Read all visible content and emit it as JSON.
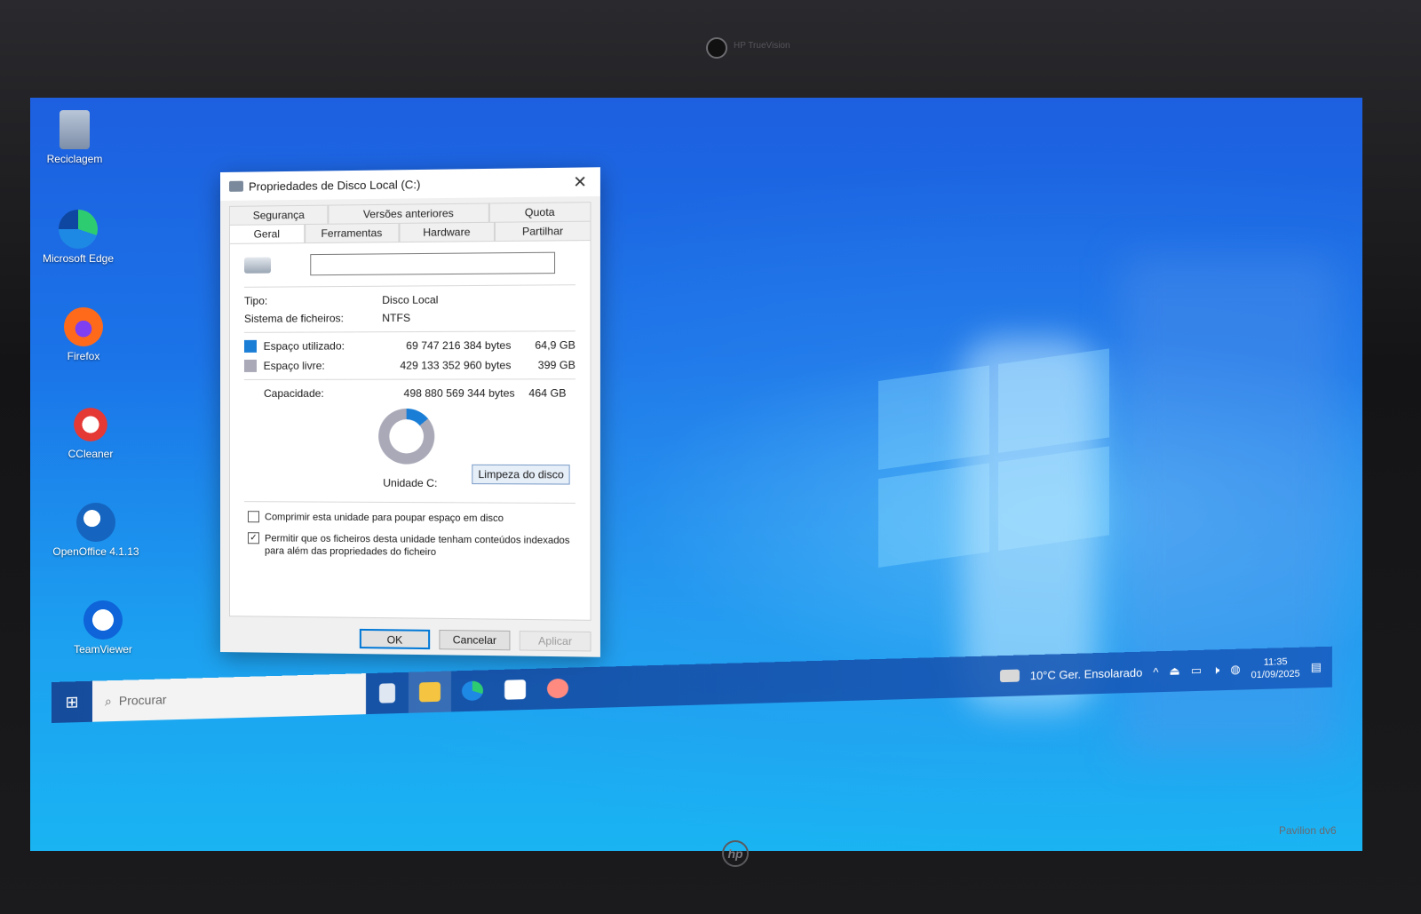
{
  "device": {
    "camera_label": "HP TrueVision",
    "brand": "hp",
    "model": "Pavilion dv6"
  },
  "desktop_icons": [
    {
      "label": "Reciclagem",
      "icon": "recycle-bin-icon"
    },
    {
      "label": "Microsoft Edge",
      "icon": "edge-icon"
    },
    {
      "label": "Firefox",
      "icon": "firefox-icon"
    },
    {
      "label": "CCleaner",
      "icon": "ccleaner-icon"
    },
    {
      "label": "OpenOffice 4.1.13",
      "icon": "openoffice-icon"
    },
    {
      "label": "TeamViewer",
      "icon": "teamviewer-icon"
    }
  ],
  "dialog": {
    "title": "Propriedades de Disco Local (C:)",
    "tabs_row1": [
      "Segurança",
      "Versões anteriores",
      "Quota"
    ],
    "tabs_row2": [
      "Geral",
      "Ferramentas",
      "Hardware",
      "Partilhar"
    ],
    "active_tab": "Geral",
    "drive_name_value": "",
    "type_label": "Tipo:",
    "type_value": "Disco Local",
    "fs_label": "Sistema de ficheiros:",
    "fs_value": "NTFS",
    "used": {
      "label": "Espaço utilizado:",
      "bytes": "69 747 216 384 bytes",
      "size": "64,9 GB",
      "color": "#1a7ed6"
    },
    "free": {
      "label": "Espaço livre:",
      "bytes": "429 133 352 960 bytes",
      "size": "399 GB",
      "color": "#a9a9b8"
    },
    "capacity": {
      "label": "Capacidade:",
      "bytes": "498 880 569 344 bytes",
      "size": "464 GB"
    },
    "used_fraction": 0.14,
    "drive_label": "Unidade C:",
    "cleanup_button": "Limpeza do disco",
    "compress_label": "Comprimir esta unidade para poupar espaço em disco",
    "compress_checked": false,
    "index_label": "Permitir que os ficheiros desta unidade tenham conteúdos indexados para além das propriedades do ficheiro",
    "index_checked": true,
    "ok_button": "OK",
    "cancel_button": "Cancelar",
    "apply_button": "Aplicar"
  },
  "taskbar": {
    "search_placeholder": "Procurar",
    "weather": "10°C  Ger. Ensolarado",
    "time": "11:35",
    "date": "01/09/2025"
  }
}
